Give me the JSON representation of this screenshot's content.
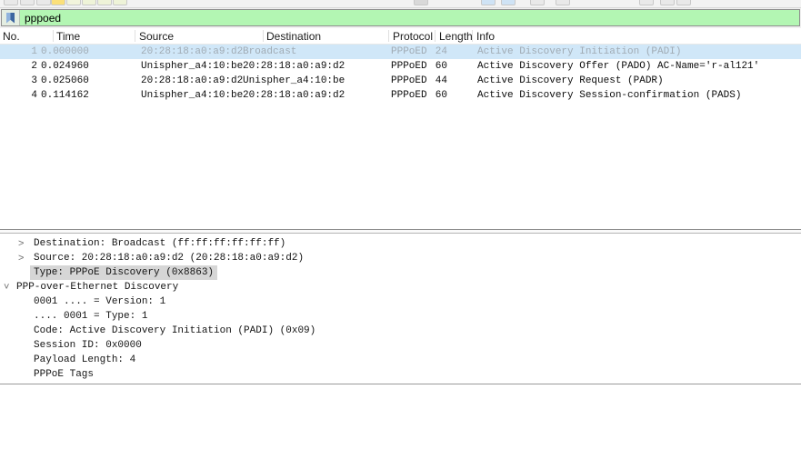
{
  "filter_bar": {
    "value": "pppoed",
    "bookmark_icon": "bookmark-icon"
  },
  "packet_list": {
    "columns": [
      "No.",
      "Time",
      "Source",
      "Destination",
      "Protocol",
      "Length",
      "Info"
    ],
    "rows": [
      {
        "no": "1",
        "time": "0.000000",
        "source": "20:28:18:a0:a9:d2",
        "destination": "Broadcast",
        "protocol": "PPPoED",
        "length": "24",
        "info": "Active Discovery Initiation (PADI)",
        "selected": true
      },
      {
        "no": "2",
        "time": "0.024960",
        "source": "Unispher_a4:10:be",
        "destination": "20:28:18:a0:a9:d2",
        "protocol": "PPPoED",
        "length": "60",
        "info": "Active Discovery Offer (PADO) AC-Name='r-al121'",
        "selected": false
      },
      {
        "no": "3",
        "time": "0.025060",
        "source": "20:28:18:a0:a9:d2",
        "destination": "Unispher_a4:10:be",
        "protocol": "PPPoED",
        "length": "44",
        "info": "Active Discovery Request (PADR)",
        "selected": false
      },
      {
        "no": "4",
        "time": "0.114162",
        "source": "Unispher_a4:10:be",
        "destination": "20:28:18:a0:a9:d2",
        "protocol": "PPPoED",
        "length": "60",
        "info": "Active Discovery Session-confirmation (PADS)",
        "selected": false
      }
    ]
  },
  "detail_pane": {
    "lines": [
      {
        "expander": "collapsed",
        "indent": 1,
        "text": "Destination: Broadcast (ff:ff:ff:ff:ff:ff)",
        "selected": false
      },
      {
        "expander": "collapsed",
        "indent": 1,
        "text": "Source: 20:28:18:a0:a9:d2 (20:28:18:a0:a9:d2)",
        "selected": false
      },
      {
        "expander": "none",
        "indent": 1,
        "text": "Type: PPPoE Discovery (0x8863)",
        "selected": true
      },
      {
        "expander": "expanded",
        "indent": 0,
        "text": "PPP-over-Ethernet Discovery",
        "selected": false
      },
      {
        "expander": "none",
        "indent": 1,
        "text": "0001 .... = Version: 1",
        "selected": false
      },
      {
        "expander": "none",
        "indent": 1,
        "text": ".... 0001 = Type: 1",
        "selected": false
      },
      {
        "expander": "none",
        "indent": 1,
        "text": "Code: Active Discovery Initiation (PADI) (0x09)",
        "selected": false
      },
      {
        "expander": "none",
        "indent": 1,
        "text": "Session ID: 0x0000",
        "selected": false
      },
      {
        "expander": "none",
        "indent": 1,
        "text": "Payload Length: 4",
        "selected": false
      },
      {
        "expander": "none",
        "indent": 1,
        "text": "PPPoE Tags",
        "selected": false
      }
    ]
  },
  "colors": {
    "filter_valid_green": "#b3f6b3",
    "selected_row_bg": "#d0e7f8",
    "selected_row_text": "#a0abb4",
    "selected_field_bg": "#d6d6d6",
    "bookmark_blue": "#3d66a0"
  }
}
